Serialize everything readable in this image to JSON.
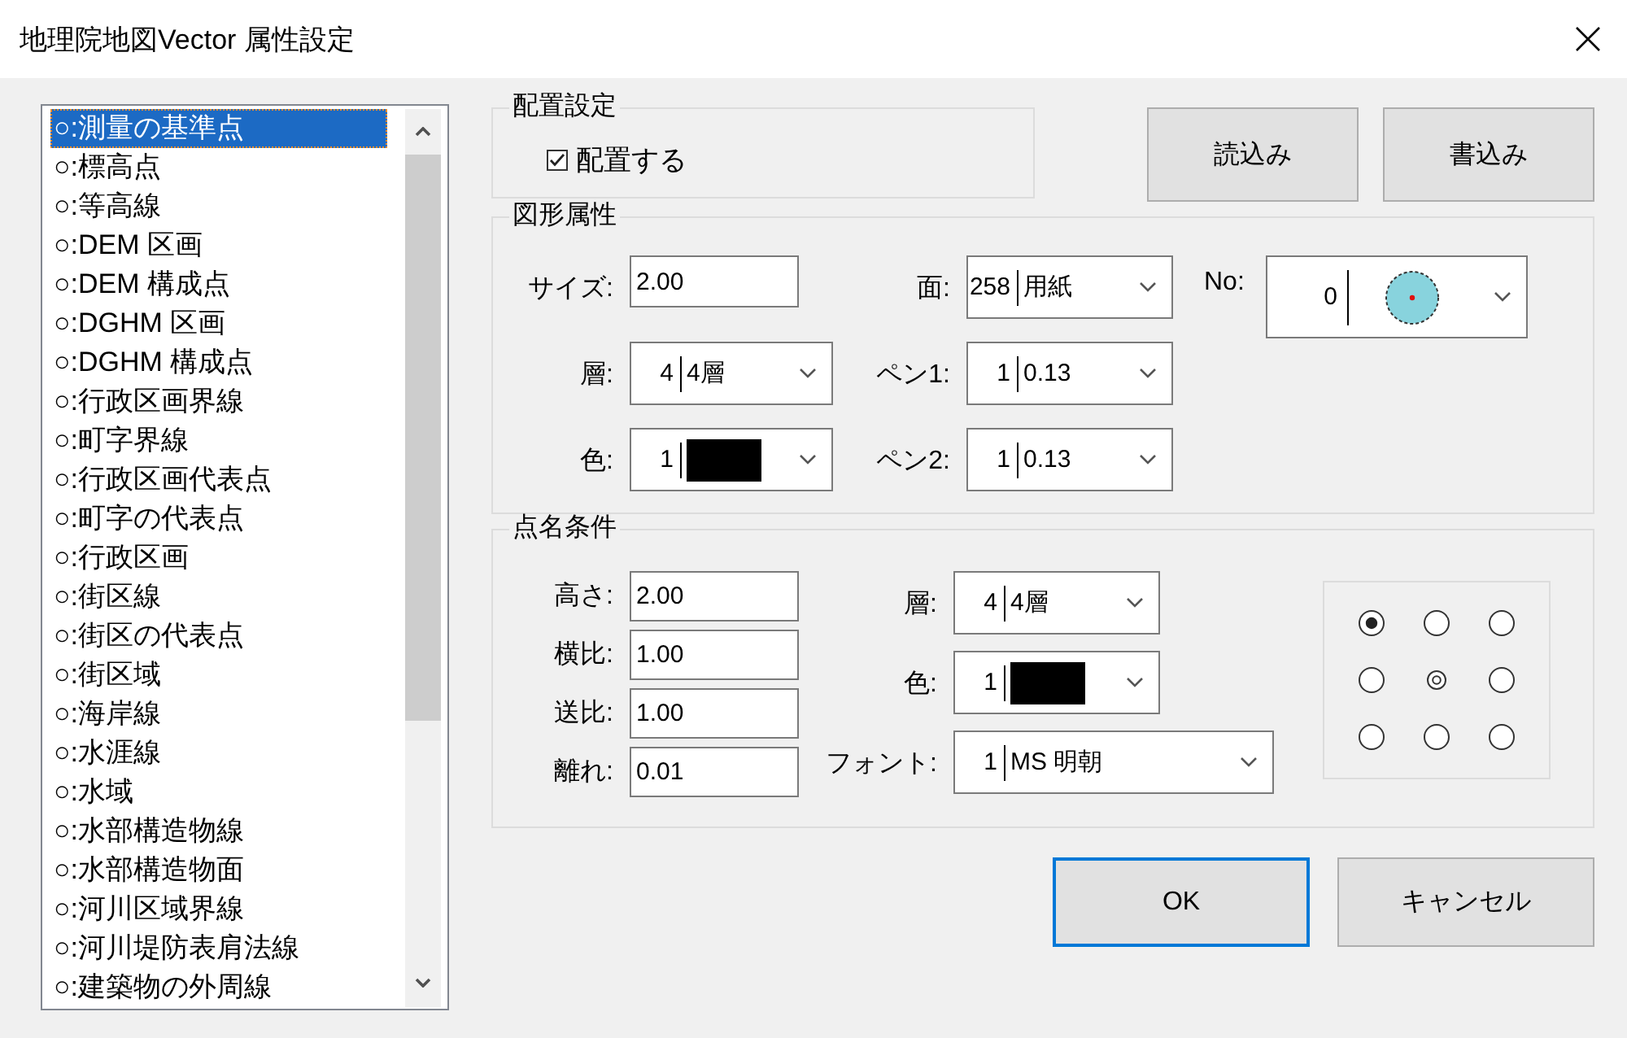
{
  "window": {
    "title": "地理院地図Vector 属性設定"
  },
  "layer_list": {
    "items": [
      {
        "label": "○:測量の基準点",
        "selected": true
      },
      {
        "label": "○:標高点",
        "selected": false
      },
      {
        "label": "○:等高線",
        "selected": false
      },
      {
        "label": "○:DEM 区画",
        "selected": false
      },
      {
        "label": "○:DEM 構成点",
        "selected": false
      },
      {
        "label": "○:DGHM 区画",
        "selected": false
      },
      {
        "label": "○:DGHM 構成点",
        "selected": false
      },
      {
        "label": "○:行政区画界線",
        "selected": false
      },
      {
        "label": "○:町字界線",
        "selected": false
      },
      {
        "label": "○:行政区画代表点",
        "selected": false
      },
      {
        "label": "○:町字の代表点",
        "selected": false
      },
      {
        "label": "○:行政区画",
        "selected": false
      },
      {
        "label": "○:街区線",
        "selected": false
      },
      {
        "label": "○:街区の代表点",
        "selected": false
      },
      {
        "label": "○:街区域",
        "selected": false
      },
      {
        "label": "○:海岸線",
        "selected": false
      },
      {
        "label": "○:水涯線",
        "selected": false
      },
      {
        "label": "○:水域",
        "selected": false
      },
      {
        "label": "○:水部構造物線",
        "selected": false
      },
      {
        "label": "○:水部構造物面",
        "selected": false
      },
      {
        "label": "○:河川区域界線",
        "selected": false
      },
      {
        "label": "○:河川堤防表肩法線",
        "selected": false
      },
      {
        "label": "○:建築物の外周線",
        "selected": false
      }
    ]
  },
  "placement": {
    "title": "配置設定",
    "checkbox": {
      "label": "配置する",
      "checked": true
    }
  },
  "file_buttons": [
    {
      "label": "読込み"
    },
    {
      "label": "書込み"
    }
  ],
  "shape_attributes": {
    "title": "図形属性",
    "rows": [
      [
        {
          "label": "サイズ:",
          "kind": "text",
          "value": "2.00"
        },
        {
          "label": "面:",
          "kind": "list",
          "number": "258",
          "value": "用紙"
        },
        {
          "label": "No:",
          "kind": "symbol",
          "number": "0"
        }
      ],
      [
        {
          "label": "層:",
          "kind": "list",
          "number": "4",
          "value": "4層"
        },
        {
          "label": "ペン1:",
          "kind": "list",
          "number": "1",
          "value": "0.13"
        }
      ],
      [
        {
          "label": "色:",
          "kind": "color",
          "number": "1",
          "color": "#000000"
        },
        {
          "label": "ペン2:",
          "kind": "list",
          "number": "1",
          "value": "0.13"
        }
      ]
    ]
  },
  "point_name": {
    "title": "点名条件",
    "size_fields": [
      {
        "label": "高さ:",
        "value": "2.00"
      },
      {
        "label": "横比:",
        "value": "1.00"
      },
      {
        "label": "送比:",
        "value": "1.00"
      },
      {
        "label": "離れ:",
        "value": "0.01"
      }
    ],
    "style_fields": [
      {
        "label": "層:",
        "kind": "list",
        "number": "4",
        "value": "4層"
      },
      {
        "label": "色:",
        "kind": "color",
        "number": "1",
        "color": "#000000"
      },
      {
        "label": "フォント:",
        "kind": "font",
        "number": "1",
        "value": "MS 明朝"
      }
    ],
    "anchor_positions": [
      {
        "kind": "radio",
        "selected": true
      },
      {
        "kind": "radio",
        "selected": false
      },
      {
        "kind": "radio",
        "selected": false
      },
      {
        "kind": "radio",
        "selected": false
      },
      {
        "kind": "center",
        "selected": false
      },
      {
        "kind": "radio",
        "selected": false
      },
      {
        "kind": "radio",
        "selected": false
      },
      {
        "kind": "radio",
        "selected": false
      },
      {
        "kind": "radio",
        "selected": false
      }
    ]
  },
  "dialog_buttons": [
    {
      "label": "OK",
      "default": true
    },
    {
      "label": "キャンセル",
      "default": false
    }
  ]
}
